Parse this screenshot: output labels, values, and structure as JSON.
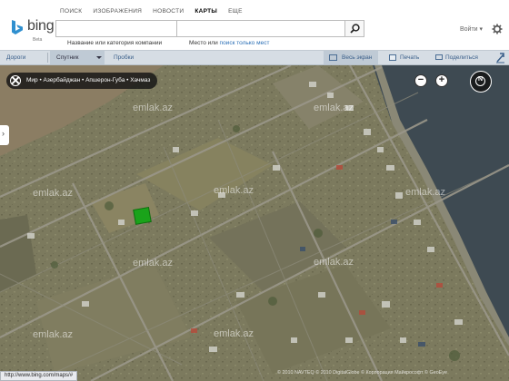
{
  "topnav": {
    "items": [
      "ПОИСК",
      "ИЗОБРАЖЕНИЯ",
      "НОВОСТИ",
      "КАРТЫ",
      "ЕЩЕ"
    ],
    "active": "КАРТЫ"
  },
  "logo": {
    "word": "bing",
    "sub": "Beta"
  },
  "search": {
    "what_value": "",
    "where_value": "",
    "hint_what": "Название или категория компании",
    "hint_where_prefix": "Место или ",
    "hint_where_link": "поиск только мест"
  },
  "header": {
    "signin": "Войти",
    "signin_arrow": "▾"
  },
  "toolbar": {
    "roads": "Дороги",
    "satellite": "Спутник",
    "traffic": "Пробки",
    "fullscreen": "Весь экран",
    "print": "Печать",
    "share": "Поделиться"
  },
  "breadcrumb": "Мир • Азербайджан • Апшерон-Губа • Хачмаз",
  "map": {
    "watermark": "emlak.az",
    "status_url": "http://www.bing.com/maps/#",
    "copyright": "© 2010 NAVTEQ  © 2010 DigitalGlobe  © Корпорация Майкрософт  © GeoEye",
    "side_tab_icon": "›",
    "zoom_out_icon": "−",
    "zoom_in_icon": "+",
    "compass_label": "N"
  },
  "colors": {
    "land": "#7c7a5e",
    "sea": "#3e4a52",
    "marker": "#1aa31a",
    "link": "#2b6fb6"
  }
}
